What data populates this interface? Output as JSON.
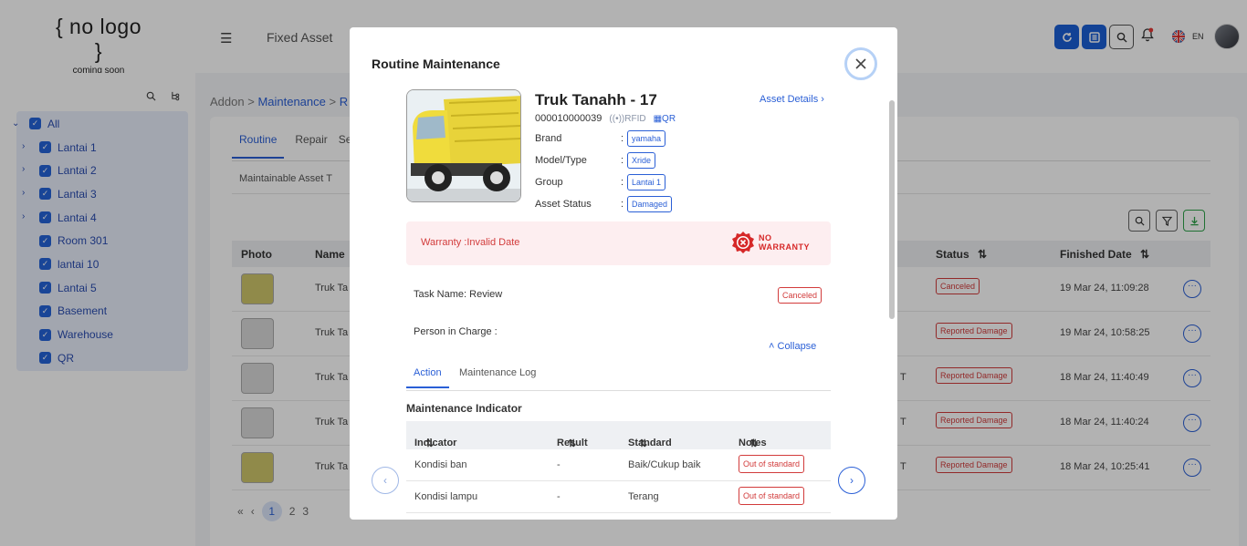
{
  "header": {
    "logo_main": "{ no logo }",
    "logo_sub": "coming soon",
    "app_title": "Fixed Asset",
    "lang": "EN"
  },
  "sidebar": {
    "items": [
      {
        "label": "All"
      },
      {
        "label": "Lantai 1"
      },
      {
        "label": "Lantai 2"
      },
      {
        "label": "Lantai 3"
      },
      {
        "label": "Lantai 4"
      },
      {
        "label": "Room 301"
      },
      {
        "label": "lantai 10"
      },
      {
        "label": "Lantai 5"
      },
      {
        "label": "Basement"
      },
      {
        "label": "Warehouse"
      },
      {
        "label": "QR"
      }
    ]
  },
  "main": {
    "breadcrumb": {
      "root": "Addon",
      "sep": ">",
      "current": "Maintenance",
      "trail": "R"
    },
    "tabs": [
      "Routine",
      "Repair",
      "Se"
    ],
    "subtabs": "Maintainable Asset   T",
    "table": {
      "headers": {
        "photo": "Photo",
        "name": "Name",
        "status": "Status",
        "finished": "Finished Date"
      },
      "rows": [
        {
          "name": "Truk Ta",
          "tail": "",
          "status": "Canceled",
          "date": "19 Mar 24, 11:09:28"
        },
        {
          "name": "Truk Ta",
          "tail": "",
          "status": "Reported Damage",
          "date": "19 Mar 24, 10:58:25"
        },
        {
          "name": "Truk Ta",
          "tail": "T",
          "status": "Reported Damage",
          "date": "18 Mar 24, 11:40:49"
        },
        {
          "name": "Truk Ta",
          "tail": "T",
          "status": "Reported Damage",
          "date": "18 Mar 24, 11:40:24"
        },
        {
          "name": "Truk Ta",
          "tail": "T",
          "status": "Reported Damage",
          "date": "18 Mar 24, 10:25:41"
        }
      ]
    },
    "pager": {
      "first": "«",
      "prev": "‹",
      "current": "1",
      "next_page": "2",
      "more": "3"
    }
  },
  "modal": {
    "title": "Routine Maintenance",
    "asset": {
      "name": "Truk Tanahh - 17",
      "code": "000010000039",
      "rfid": "RFID",
      "qr": "QR",
      "details_link": "Asset Details",
      "brand_label": "Brand",
      "brand": "yamaha",
      "model_label": "Model/Type",
      "model": "Xride",
      "group_label": "Group",
      "group": "Lantai 1",
      "status_label": "Asset Status",
      "status": "Damaged",
      "colon": ":"
    },
    "warranty": {
      "text": "Warranty :Invalid Date",
      "badge_line1": "NO",
      "badge_line2": "WARRANTY"
    },
    "task": {
      "name": "Task Name: Review",
      "status": "Canceled",
      "person": "Person in Charge :",
      "collapse": "Collapse"
    },
    "tabs": {
      "action": "Action",
      "log": "Maintenance Log"
    },
    "indicator": {
      "title": "Maintenance Indicator",
      "headers": {
        "indicator": "Indicator",
        "result": "Result",
        "standard": "Standard",
        "notes": "Notes"
      },
      "rows": [
        {
          "indicator": "Kondisi ban",
          "result": "-",
          "standard": "Baik/Cukup baik",
          "notes": "Out of standard"
        },
        {
          "indicator": "Kondisi lampu",
          "result": "-",
          "standard": "Terang",
          "notes": "Out of standard"
        }
      ]
    },
    "sort_glyph": "⇅"
  },
  "colors": {
    "accent": "#2a5fd6",
    "danger": "#d23b3b",
    "primary_button": "#1a5fd6"
  }
}
